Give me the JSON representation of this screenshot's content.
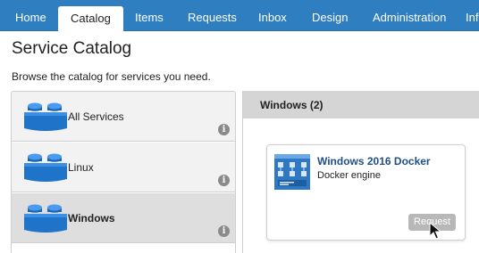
{
  "nav": {
    "tabs": [
      {
        "label": "Home"
      },
      {
        "label": "Catalog",
        "active": true
      },
      {
        "label": "Items"
      },
      {
        "label": "Requests"
      },
      {
        "label": "Inbox"
      },
      {
        "label": "Design"
      },
      {
        "label": "Administration"
      },
      {
        "label": "Inf"
      }
    ]
  },
  "page": {
    "title": "Service Catalog",
    "subtitle": "Browse the catalog for services you need."
  },
  "categories": [
    {
      "label": "All Services",
      "icon": "lego-brick-icon"
    },
    {
      "label": "Linux",
      "icon": "lego-brick-icon"
    },
    {
      "label": "Windows",
      "icon": "lego-brick-icon",
      "selected": true
    }
  ],
  "panel": {
    "header": "Windows (2)",
    "card": {
      "title": "Windows 2016 Docker",
      "description": "Docker engine",
      "request_label": "Request",
      "icon": "blueprint-icon"
    }
  },
  "colors": {
    "nav_bg": "#2f7ec0",
    "title_link": "#1f4f84",
    "lego_blue": "#1f73c8",
    "selected_row": "#dedede"
  }
}
